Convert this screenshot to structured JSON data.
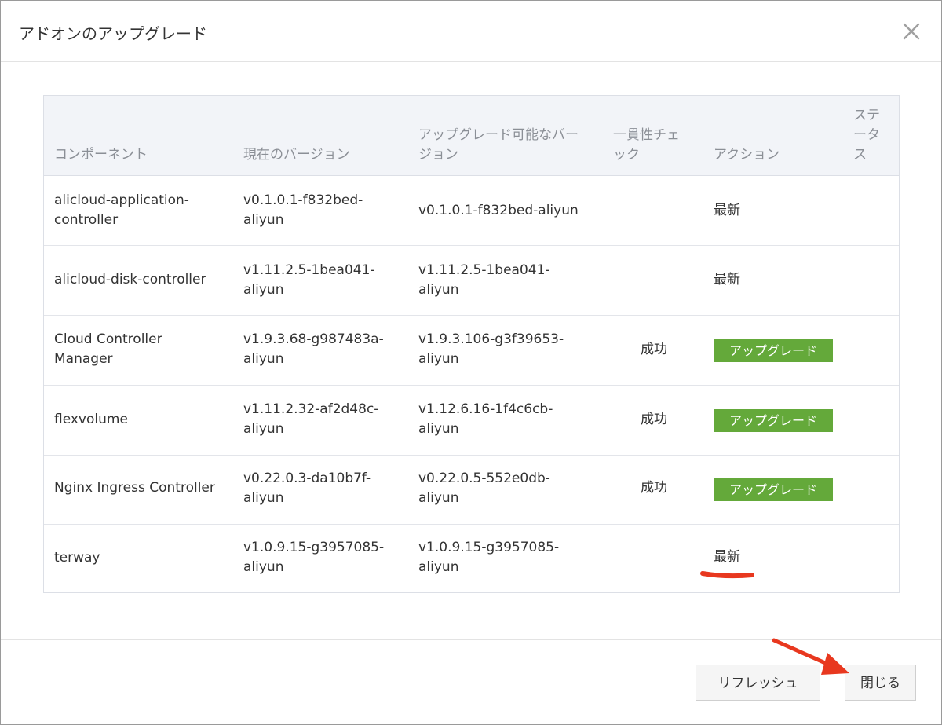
{
  "dialog": {
    "title": "アドオンのアップグレード",
    "close_icon": "close-icon"
  },
  "table": {
    "headers": {
      "component": "コンポーネント",
      "current_line1": "現在のバージョン",
      "upgradable_line1": "アップグレード可能なバー",
      "upgradable_line2": "ジョン",
      "consistency_line1": "一貫性チェ",
      "consistency_line2": "ック",
      "action": "アクション",
      "status_line1": "ステ",
      "status_line2": "ータ",
      "status_line3": "ス"
    },
    "rows": [
      {
        "component_l1": "alicloud-application-",
        "component_l2": "controller",
        "current_l1": "v0.1.0.1-f832bed-",
        "current_l2": "aliyun",
        "upgradable_l1": "v0.1.0.1-f832bed-aliyun",
        "upgradable_l2": "",
        "check": "",
        "action": "最新"
      },
      {
        "component_l1": "alicloud-disk-controller",
        "component_l2": "",
        "current_l1": "v1.11.2.5-1bea041-",
        "current_l2": "aliyun",
        "upgradable_l1": "v1.11.2.5-1bea041-",
        "upgradable_l2": "aliyun",
        "check": "",
        "action": "最新"
      },
      {
        "component_l1": "Cloud Controller",
        "component_l2": "Manager",
        "current_l1": "v1.9.3.68-g987483a-",
        "current_l2": "aliyun",
        "upgradable_l1": "v1.9.3.106-g3f39653-",
        "upgradable_l2": "aliyun",
        "check": "成功",
        "action": "アップグレード"
      },
      {
        "component_l1": "flexvolume",
        "component_l2": "",
        "current_l1": "v1.11.2.32-af2d48c-",
        "current_l2": "aliyun",
        "upgradable_l1": "v1.12.6.16-1f4c6cb-",
        "upgradable_l2": "aliyun",
        "check": "成功",
        "action": "アップグレード"
      },
      {
        "component_l1": "Nginx Ingress Controller",
        "component_l2": "",
        "current_l1": "v0.22.0.3-da10b7f-",
        "current_l2": "aliyun",
        "upgradable_l1": "v0.22.0.5-552e0db-",
        "upgradable_l2": "aliyun",
        "check": "成功",
        "action": "アップグレード"
      },
      {
        "component_l1": "terway",
        "component_l2": "",
        "current_l1": "v1.0.9.15-g3957085-",
        "current_l2": "aliyun",
        "upgradable_l1": "v1.0.9.15-g3957085-",
        "upgradable_l2": "aliyun",
        "check": "",
        "action": "最新"
      }
    ]
  },
  "footer": {
    "refresh_label": "リフレッシュ",
    "close_label": "閉じる"
  },
  "colors": {
    "upgrade_button": "#64a93a",
    "annotation": "#e8381f",
    "header_bg": "#f2f4f8"
  }
}
